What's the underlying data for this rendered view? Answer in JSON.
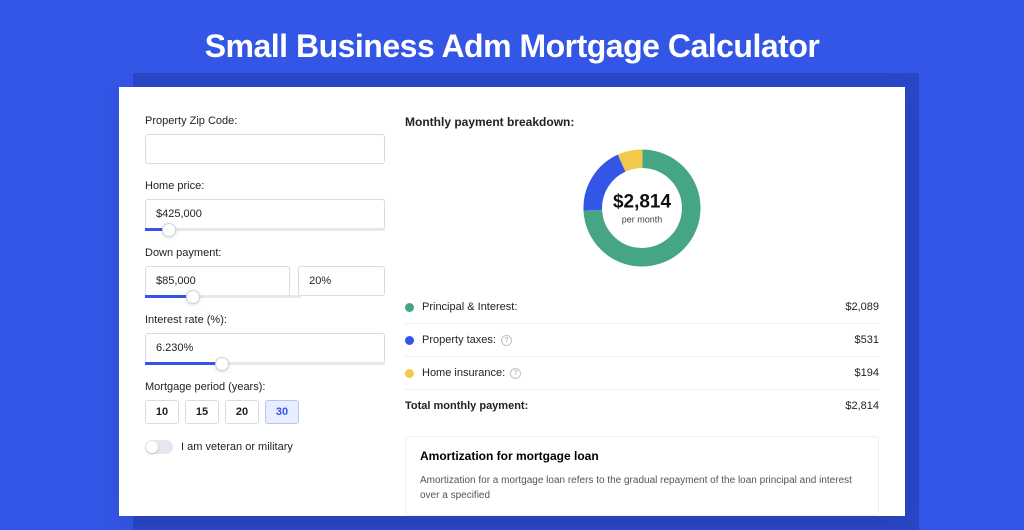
{
  "page": {
    "title": "Small Business Adm Mortgage Calculator"
  },
  "form": {
    "zip_label": "Property Zip Code:",
    "zip_value": "",
    "home_price_label": "Home price:",
    "home_price_value": "$425,000",
    "home_price_slider_pct": 10,
    "down_payment_label": "Down payment:",
    "down_payment_amount": "$85,000",
    "down_payment_pct": "20%",
    "down_payment_slider_pct": 20,
    "interest_rate_label": "Interest rate (%):",
    "interest_rate_value": "6.230%",
    "interest_rate_slider_pct": 32,
    "period_label": "Mortgage period (years):",
    "period_options": [
      "10",
      "15",
      "20",
      "30"
    ],
    "period_selected": "30",
    "veteran_label": "I am veteran or military"
  },
  "breakdown": {
    "title": "Monthly payment breakdown:",
    "donut_amount": "$2,814",
    "donut_sub": "per month",
    "rows": [
      {
        "color": "green",
        "label": "Principal & Interest:",
        "value": "$2,089",
        "info": false
      },
      {
        "color": "blue",
        "label": "Property taxes:",
        "value": "$531",
        "info": true
      },
      {
        "color": "yellow",
        "label": "Home insurance:",
        "value": "$194",
        "info": true
      }
    ],
    "total_label": "Total monthly payment:",
    "total_value": "$2,814"
  },
  "chart_data": {
    "type": "pie",
    "title": "Monthly payment breakdown",
    "series": [
      {
        "name": "Principal & Interest",
        "value": 2089,
        "color": "#46a582"
      },
      {
        "name": "Property taxes",
        "value": 531,
        "color": "#3356e6"
      },
      {
        "name": "Home insurance",
        "value": 194,
        "color": "#f2c94a"
      }
    ],
    "total": 2814,
    "center_label": "$2,814",
    "center_sub": "per month"
  },
  "amort": {
    "title": "Amortization for mortgage loan",
    "text": "Amortization for a mortgage loan refers to the gradual repayment of the loan principal and interest over a specified"
  }
}
